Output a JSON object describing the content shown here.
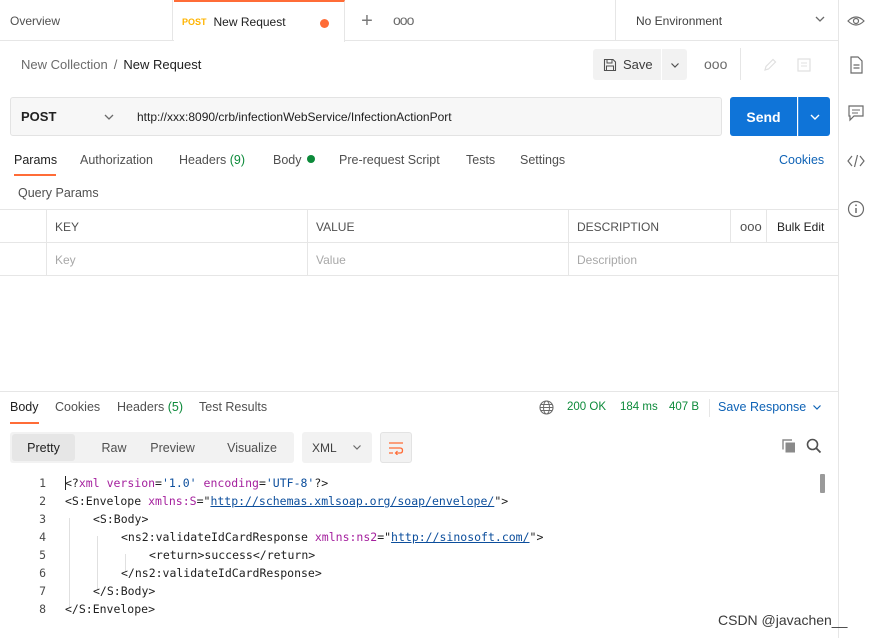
{
  "tabs": {
    "overview": "Overview",
    "active_method": "POST",
    "active_label": "New Request",
    "more": "ooo",
    "environment": "No Environment"
  },
  "breadcrumb": {
    "collection": "New Collection",
    "separator": "/",
    "request": "New Request"
  },
  "toolbar": {
    "save_label": "Save",
    "more": "ooo"
  },
  "request": {
    "method": "POST",
    "url": "http://xxx:8090/crb/infectionWebService/InfectionActionPort",
    "send_label": "Send"
  },
  "request_tabs": {
    "params": "Params",
    "authorization": "Authorization",
    "headers": "Headers",
    "headers_count": "(9)",
    "body": "Body",
    "pre_request": "Pre-request Script",
    "tests": "Tests",
    "settings": "Settings",
    "cookies": "Cookies"
  },
  "params": {
    "title": "Query Params",
    "columns": [
      "KEY",
      "VALUE",
      "DESCRIPTION"
    ],
    "more": "ooo",
    "bulk_edit": "Bulk Edit",
    "placeholders": [
      "Key",
      "Value",
      "Description"
    ]
  },
  "response": {
    "tabs": {
      "body": "Body",
      "cookies": "Cookies",
      "headers": "Headers",
      "headers_count": "(5)",
      "test_results": "Test Results"
    },
    "status": "200 OK",
    "time": "184 ms",
    "size": "407 B",
    "save_response": "Save Response",
    "views": [
      "Pretty",
      "Raw",
      "Preview",
      "Visualize"
    ],
    "format": "XML",
    "line_numbers": [
      "1",
      "2",
      "3",
      "4",
      "5",
      "6",
      "7",
      "8"
    ],
    "code": {
      "l1": {
        "open": "<?",
        "xml": "xml",
        "a1": "version",
        "v1": "'1.0'",
        "a2": "encoding",
        "v2": "'UTF-8'",
        "close": "?>"
      },
      "l2": {
        "tag": "<S:Envelope",
        "attr": "xmlns:S",
        "eq": "=\"",
        "url": "http://schemas.xmlsoap.org/soap/envelope/",
        "end": "\">"
      },
      "l3": "<S:Body>",
      "l4": {
        "tag": "<ns2:validateIdCardResponse",
        "attr": "xmlns:ns2",
        "eq": "=\"",
        "url": "http://sinosoft.com/",
        "end": "\">"
      },
      "l5": {
        "open": "<return>",
        "text": "success",
        "close": "</return>"
      },
      "l6": "</ns2:validateIdCardResponse>",
      "l7": "</S:Body>",
      "l8": "</S:Envelope>"
    }
  },
  "watermark": "CSDN @javachen__",
  "colors": {
    "accent": "#ff6c37",
    "send": "#0f74d8",
    "success": "#0c8a3a",
    "link": "#0f63b6"
  }
}
